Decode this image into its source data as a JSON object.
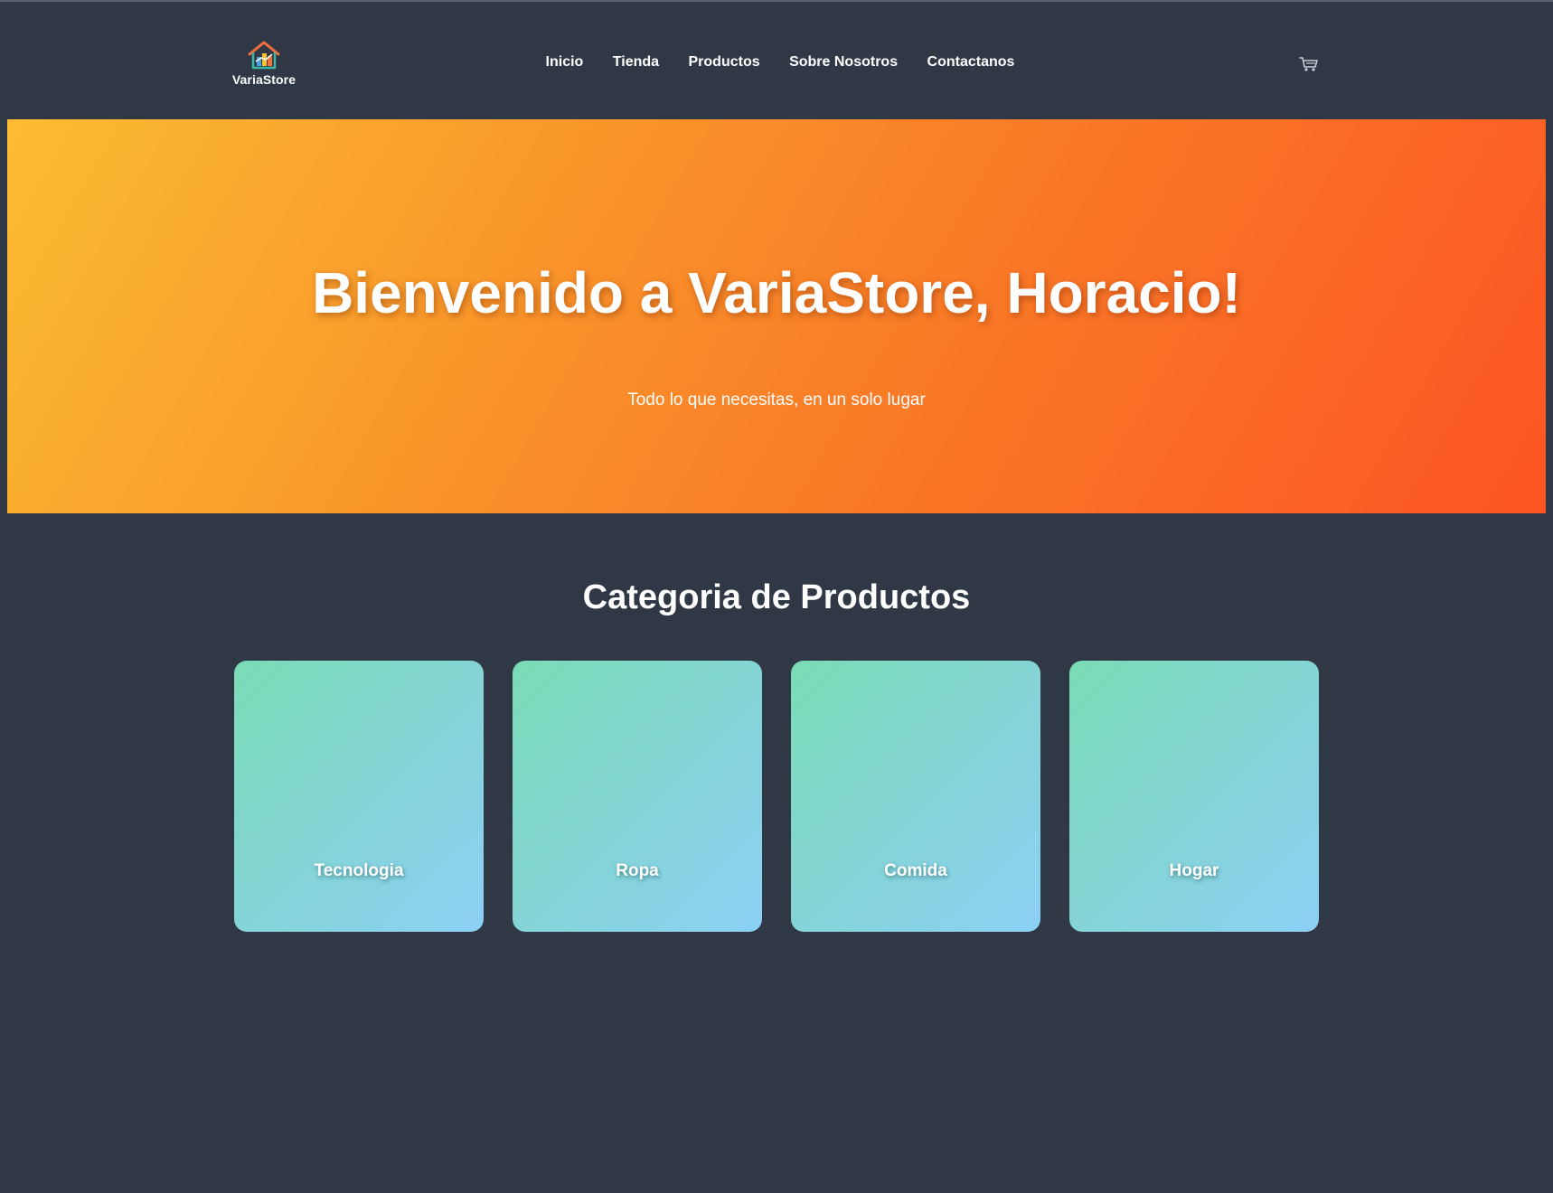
{
  "header": {
    "logo_text": "VariaStore",
    "nav": [
      "Inicio",
      "Tienda",
      "Productos",
      "Sobre Nosotros",
      "Contactanos"
    ],
    "cart_icon": "shopping-cart-icon"
  },
  "hero": {
    "title": "Bienvenido a VariaStore, Horacio!",
    "subtitle": "Todo lo que necesitas, en un solo lugar",
    "gradient_colors": [
      "#fbbc32",
      "#fc5523"
    ]
  },
  "categories": {
    "title": "Categoria de Productos",
    "items": [
      "Tecnologia",
      "Ropa",
      "Comida",
      "Hogar"
    ],
    "card_gradient": [
      "#7adcb5",
      "#8cd0f5"
    ]
  },
  "colors": {
    "background": "#303846",
    "text": "#ffffff"
  }
}
